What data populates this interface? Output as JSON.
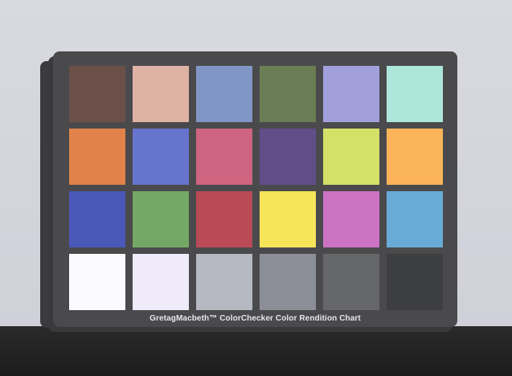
{
  "chart": {
    "caption": "GretagMacbeth™ ColorChecker Color Rendition Chart"
  },
  "colors": {
    "background": "#d6d6de",
    "card": "#4a4a4c",
    "table": "#222122"
  },
  "patches": [
    [
      "#6b5049",
      "#dfb2a6",
      "#8296c6",
      "#6b7d55",
      "#a1a0dc",
      "#aee6dc"
    ],
    [
      "#e08249",
      "#6674cd",
      "#cf6480",
      "#614e88",
      "#d4e067",
      "#fbb45a"
    ],
    [
      "#4a58b7",
      "#74a865",
      "#b94a56",
      "#f6e459",
      "#cc72c3",
      "#68abd6"
    ],
    [
      "#fbfbfd",
      "#efebfb",
      "#b6b8c2",
      "#8d8f98",
      "#666769",
      "#3d3e40"
    ]
  ]
}
